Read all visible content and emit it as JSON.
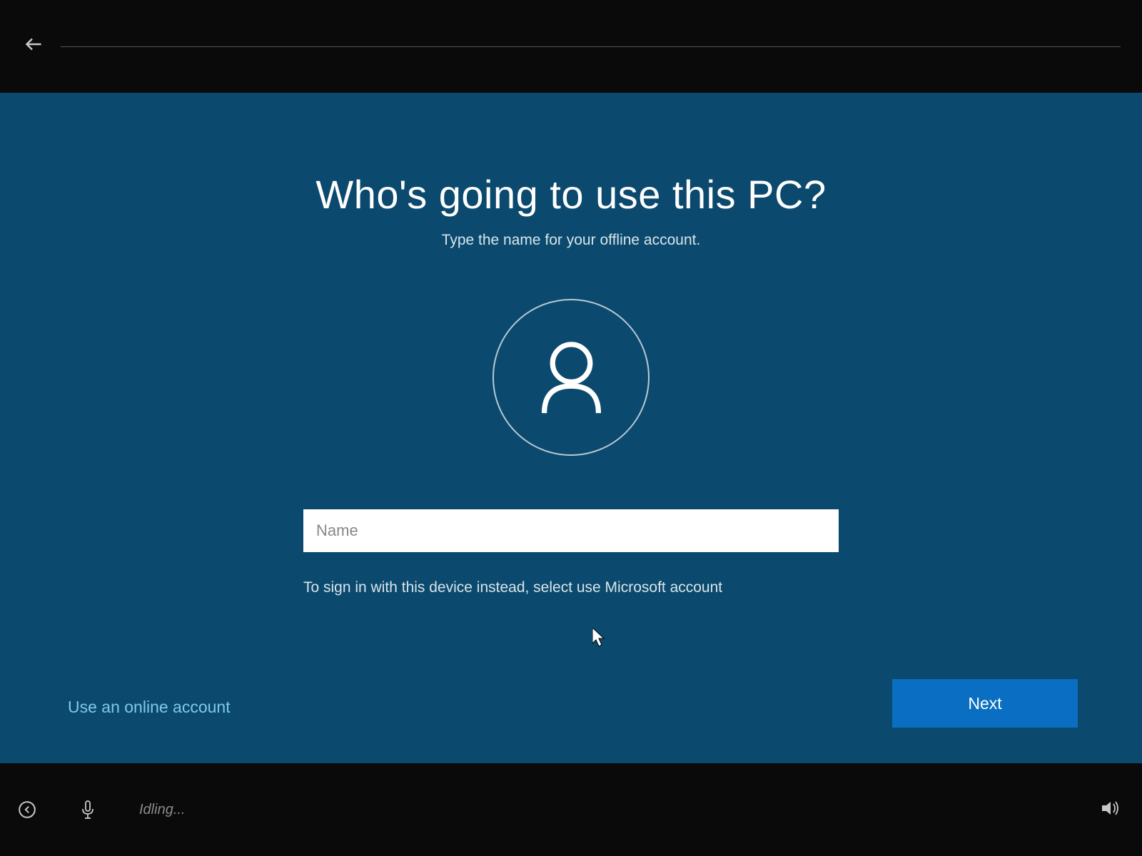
{
  "heading": "Who's going to use this PC?",
  "subheading": "Type the name for your offline account.",
  "name_input": {
    "placeholder": "Name",
    "value": ""
  },
  "hint": "To sign in with this device instead, select use Microsoft account",
  "use_online_label": "Use an online account",
  "next_label": "Next",
  "status_text": "Idling..."
}
